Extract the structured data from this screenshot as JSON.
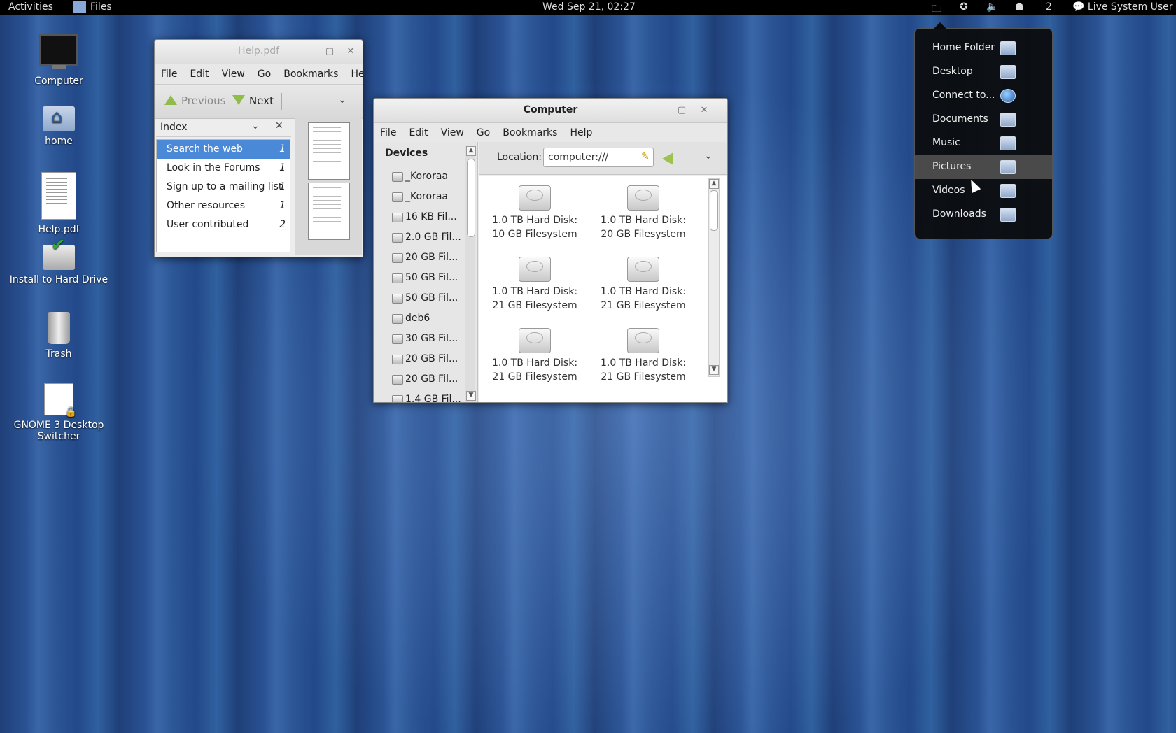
{
  "topbar": {
    "activities": "Activities",
    "app_name": "Files",
    "clock": "Wed Sep 21, 02:27",
    "workspace_count": "2",
    "user": "Live System User"
  },
  "desktop": {
    "icons": [
      {
        "label": "Computer"
      },
      {
        "label": "home"
      },
      {
        "label": "Help.pdf"
      },
      {
        "label": "Install to Hard Drive"
      },
      {
        "label": "Trash"
      },
      {
        "label": "GNOME 3 Desktop Switcher"
      }
    ]
  },
  "help_window": {
    "title": "Help.pdf",
    "menu": [
      "File",
      "Edit",
      "View",
      "Go",
      "Bookmarks",
      "Help"
    ],
    "toolbar": {
      "previous": "Previous",
      "next": "Next"
    },
    "index_label": "Index",
    "index_rows": [
      {
        "title": "Search the web",
        "page": "1"
      },
      {
        "title": "Look in the Forums",
        "page": "1"
      },
      {
        "title": "Sign up to a mailing list",
        "page": "1"
      },
      {
        "title": "Other resources",
        "page": "1"
      },
      {
        "title": "User contributed",
        "page": "2"
      }
    ]
  },
  "computer_window": {
    "title": "Computer",
    "menu": [
      "File",
      "Edit",
      "View",
      "Go",
      "Bookmarks",
      "Help"
    ],
    "sidebar_heading": "Devices",
    "devices": [
      "_Kororaa",
      "_Kororaa",
      "16 KB Fil...",
      "2.0 GB Fil...",
      "20 GB Fil...",
      "50 GB Fil...",
      "50 GB Fil...",
      "deb6",
      "30 GB Fil...",
      "20 GB Fil...",
      "20 GB Fil...",
      "1.4 GB Fil..."
    ],
    "location_label": "Location:",
    "location_value": "computer:///",
    "drives": [
      {
        "line1": "1.0 TB Hard Disk:",
        "line2": "10 GB Filesystem"
      },
      {
        "line1": "1.0 TB Hard Disk:",
        "line2": "20 GB Filesystem"
      },
      {
        "line1": "1.0 TB Hard Disk:",
        "line2": "21 GB Filesystem"
      },
      {
        "line1": "1.0 TB Hard Disk:",
        "line2": "21 GB Filesystem"
      },
      {
        "line1": "1.0 TB Hard Disk:",
        "line2": "21 GB Filesystem"
      },
      {
        "line1": "1.0 TB Hard Disk:",
        "line2": "21 GB Filesystem"
      }
    ]
  },
  "places_menu": {
    "items": [
      "Home Folder",
      "Desktop",
      "Connect to...",
      "Documents",
      "Music",
      "Pictures",
      "Videos",
      "Downloads"
    ],
    "highlighted": "Pictures"
  }
}
